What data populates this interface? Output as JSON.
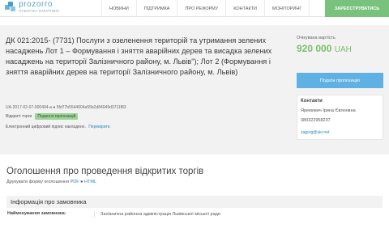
{
  "logo": {
    "name": "prozorro",
    "sub": "публічні закупівлі",
    "icon": "prozorro-logo-icon"
  },
  "nav": {
    "items": [
      "НОВИНИ",
      "ПІДТРИМКА",
      "ПРО РЕФОРМУ",
      "КОНТАКТИ",
      "МОНІТОРИНГ"
    ],
    "register_label": "ЗАРЕЄСТРУВАТИСЬ"
  },
  "tender": {
    "title": "ДК 021:2015- (7731) Послуги з озеленення територій та утримання зелених насаджень Лот 1 – Формування і зняття аварійних дерев та висадка зелених насаджень на території Залізничного району, м. Львів\"); Лот 2 (Формування і зняття аварійних дерев на території Залізничного району, м. Львів)",
    "id": "UA-2017-02-07-000494-a ● 5fd77b5544604a55b2d84949d3711f83",
    "procedure": "Відкриті торги",
    "status": "Подання пропозицій",
    "signature_text": "Електронний цифровий підпис накладено.",
    "signature_link": "Перевірити"
  },
  "side": {
    "estimated_label": "Очікувана вартість",
    "estimated_value": "920 000",
    "currency": "UAH",
    "submit_label": "Подати пропозицію",
    "contacts_title": "Контакти",
    "contact_name": "Яремович Ірина Євгенівна",
    "contact_phone": "380322958237",
    "contact_email": "zagorg@ukr.net"
  },
  "announcement": {
    "title": "Оголошення про проведення відкритих торгів",
    "print_prefix": "Друкувати форму оголошення",
    "pdf_label": "PDF",
    "html_label": "HTML",
    "sep": "●"
  },
  "customer": {
    "section_title": "Інформація про замовника",
    "name_label": "Найменування замовника:",
    "name_value": "Залізнична районна адміністрація Львівської міської ради"
  },
  "colors": {
    "accent_green": "#79bf6a",
    "accent_blue": "#5eb1e2",
    "link": "#2a84c3",
    "register_bg": "#78c27e"
  }
}
